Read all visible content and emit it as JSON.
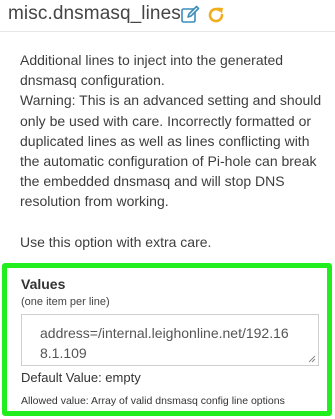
{
  "setting": {
    "name": "misc.dnsmasq_lines",
    "description_lines": [
      "Additional lines to inject into the generated dnsmasq configuration.",
      "Warning: This is an advanced setting and should only be used with care. Incorrectly formatted or duplicated lines as well as lines conflicting with the automatic configuration of Pi-hole can break the embedded dnsmasq and will stop DNS resolution from working."
    ],
    "extra_care": "Use this option with extra care."
  },
  "icons": {
    "edit": "edit-icon",
    "reload": "reload-icon",
    "edit_color": "#3c8dbc",
    "reload_color": "#f0ad1e"
  },
  "values": {
    "title": "Values",
    "hint": "(one item per line)",
    "textarea_value": "address=/internal.leighonline.net/192.168.1.109",
    "default_value": "Default Value: empty",
    "allowed_value": "Allowed value: Array of valid dnsmasq config line options"
  },
  "colors": {
    "highlight": "#22ee1e"
  }
}
